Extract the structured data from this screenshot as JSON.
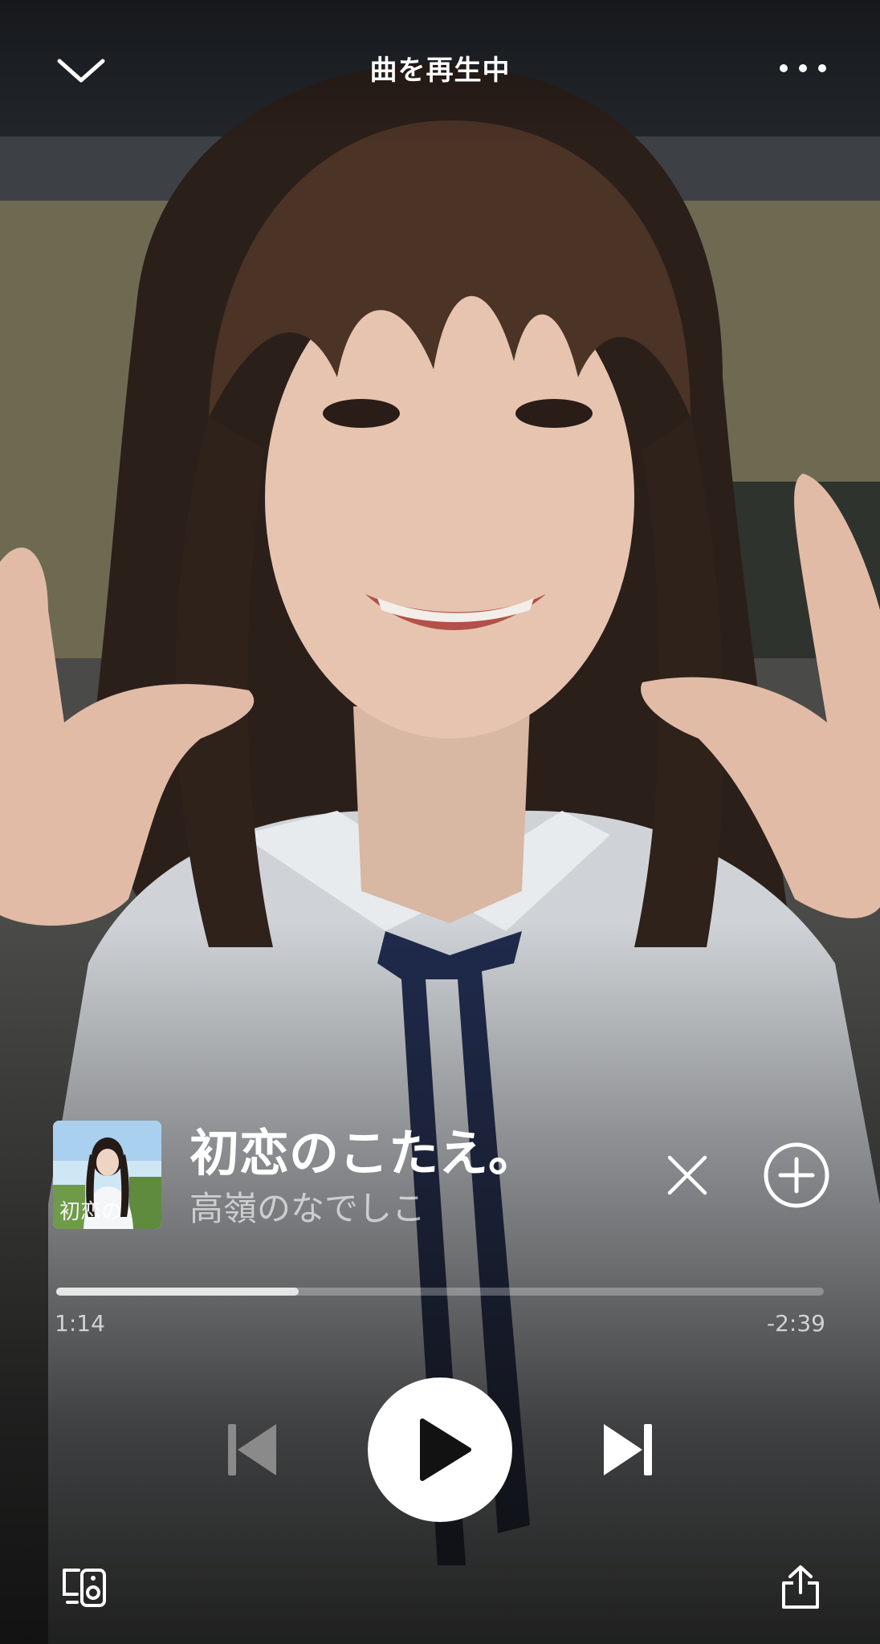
{
  "header": {
    "title": "曲を再生中"
  },
  "track": {
    "title": "初恋のこたえ。",
    "artist": "高嶺のなでしこ",
    "cover_icon": "album-cover"
  },
  "progress": {
    "elapsed": "1:14",
    "remaining": "-2:39",
    "fraction": 0.316
  },
  "icons": {
    "collapse": "chevron-down-icon",
    "more": "more-icon",
    "remove": "close-icon",
    "add": "add-circle-icon",
    "previous": "skip-previous-icon",
    "play": "play-icon",
    "next": "skip-next-icon",
    "devices": "connect-devices-icon",
    "share": "share-icon"
  },
  "colors": {
    "accent": "#ffffff",
    "progress_fill": "#d0d0d0",
    "progress_track": "#6b6b6b",
    "play_button_bg": "#ffffff",
    "play_button_icon": "#121212",
    "prev_disabled": "#8a8a8a"
  }
}
